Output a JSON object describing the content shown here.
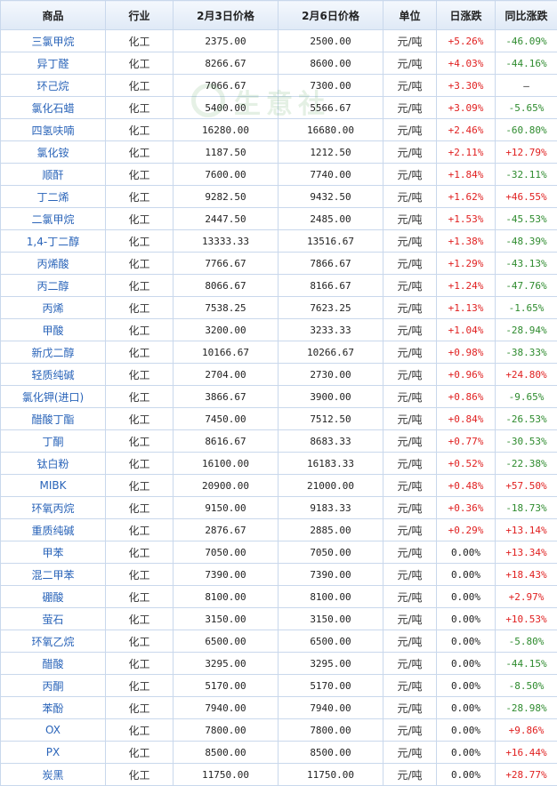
{
  "headers": [
    "商品",
    "行业",
    "2月3日价格",
    "2月6日价格",
    "单位",
    "日涨跌",
    "同比涨跌"
  ],
  "watermark_text": "生意社",
  "rows": [
    {
      "name": "三氯甲烷",
      "industry": "化工",
      "p1": "2375.00",
      "p2": "2500.00",
      "unit": "元/吨",
      "day": "+5.26%",
      "yoy": "-46.09%"
    },
    {
      "name": "异丁醛",
      "industry": "化工",
      "p1": "8266.67",
      "p2": "8600.00",
      "unit": "元/吨",
      "day": "+4.03%",
      "yoy": "-44.16%"
    },
    {
      "name": "环己烷",
      "industry": "化工",
      "p1": "7066.67",
      "p2": "7300.00",
      "unit": "元/吨",
      "day": "+3.30%",
      "yoy": "—"
    },
    {
      "name": "氯化石蜡",
      "industry": "化工",
      "p1": "5400.00",
      "p2": "5566.67",
      "unit": "元/吨",
      "day": "+3.09%",
      "yoy": "-5.65%"
    },
    {
      "name": "四氢呋喃",
      "industry": "化工",
      "p1": "16280.00",
      "p2": "16680.00",
      "unit": "元/吨",
      "day": "+2.46%",
      "yoy": "-60.80%"
    },
    {
      "name": "氯化铵",
      "industry": "化工",
      "p1": "1187.50",
      "p2": "1212.50",
      "unit": "元/吨",
      "day": "+2.11%",
      "yoy": "+12.79%"
    },
    {
      "name": "顺酐",
      "industry": "化工",
      "p1": "7600.00",
      "p2": "7740.00",
      "unit": "元/吨",
      "day": "+1.84%",
      "yoy": "-32.11%"
    },
    {
      "name": "丁二烯",
      "industry": "化工",
      "p1": "9282.50",
      "p2": "9432.50",
      "unit": "元/吨",
      "day": "+1.62%",
      "yoy": "+46.55%"
    },
    {
      "name": "二氯甲烷",
      "industry": "化工",
      "p1": "2447.50",
      "p2": "2485.00",
      "unit": "元/吨",
      "day": "+1.53%",
      "yoy": "-45.53%"
    },
    {
      "name": "1,4-丁二醇",
      "industry": "化工",
      "p1": "13333.33",
      "p2": "13516.67",
      "unit": "元/吨",
      "day": "+1.38%",
      "yoy": "-48.39%"
    },
    {
      "name": "丙烯酸",
      "industry": "化工",
      "p1": "7766.67",
      "p2": "7866.67",
      "unit": "元/吨",
      "day": "+1.29%",
      "yoy": "-43.13%"
    },
    {
      "name": "丙二醇",
      "industry": "化工",
      "p1": "8066.67",
      "p2": "8166.67",
      "unit": "元/吨",
      "day": "+1.24%",
      "yoy": "-47.76%"
    },
    {
      "name": "丙烯",
      "industry": "化工",
      "p1": "7538.25",
      "p2": "7623.25",
      "unit": "元/吨",
      "day": "+1.13%",
      "yoy": "-1.65%"
    },
    {
      "name": "甲酸",
      "industry": "化工",
      "p1": "3200.00",
      "p2": "3233.33",
      "unit": "元/吨",
      "day": "+1.04%",
      "yoy": "-28.94%"
    },
    {
      "name": "新戊二醇",
      "industry": "化工",
      "p1": "10166.67",
      "p2": "10266.67",
      "unit": "元/吨",
      "day": "+0.98%",
      "yoy": "-38.33%"
    },
    {
      "name": "轻质纯碱",
      "industry": "化工",
      "p1": "2704.00",
      "p2": "2730.00",
      "unit": "元/吨",
      "day": "+0.96%",
      "yoy": "+24.80%"
    },
    {
      "name": "氯化钾(进口)",
      "industry": "化工",
      "p1": "3866.67",
      "p2": "3900.00",
      "unit": "元/吨",
      "day": "+0.86%",
      "yoy": "-9.65%"
    },
    {
      "name": "醋酸丁酯",
      "industry": "化工",
      "p1": "7450.00",
      "p2": "7512.50",
      "unit": "元/吨",
      "day": "+0.84%",
      "yoy": "-26.53%"
    },
    {
      "name": "丁酮",
      "industry": "化工",
      "p1": "8616.67",
      "p2": "8683.33",
      "unit": "元/吨",
      "day": "+0.77%",
      "yoy": "-30.53%"
    },
    {
      "name": "钛白粉",
      "industry": "化工",
      "p1": "16100.00",
      "p2": "16183.33",
      "unit": "元/吨",
      "day": "+0.52%",
      "yoy": "-22.38%"
    },
    {
      "name": "MIBK",
      "industry": "化工",
      "p1": "20900.00",
      "p2": "21000.00",
      "unit": "元/吨",
      "day": "+0.48%",
      "yoy": "+57.50%"
    },
    {
      "name": "环氧丙烷",
      "industry": "化工",
      "p1": "9150.00",
      "p2": "9183.33",
      "unit": "元/吨",
      "day": "+0.36%",
      "yoy": "-18.73%"
    },
    {
      "name": "重质纯碱",
      "industry": "化工",
      "p1": "2876.67",
      "p2": "2885.00",
      "unit": "元/吨",
      "day": "+0.29%",
      "yoy": "+13.14%"
    },
    {
      "name": "甲苯",
      "industry": "化工",
      "p1": "7050.00",
      "p2": "7050.00",
      "unit": "元/吨",
      "day": "0.00%",
      "yoy": "+13.34%"
    },
    {
      "name": "混二甲苯",
      "industry": "化工",
      "p1": "7390.00",
      "p2": "7390.00",
      "unit": "元/吨",
      "day": "0.00%",
      "yoy": "+18.43%"
    },
    {
      "name": "硼酸",
      "industry": "化工",
      "p1": "8100.00",
      "p2": "8100.00",
      "unit": "元/吨",
      "day": "0.00%",
      "yoy": "+2.97%"
    },
    {
      "name": "萤石",
      "industry": "化工",
      "p1": "3150.00",
      "p2": "3150.00",
      "unit": "元/吨",
      "day": "0.00%",
      "yoy": "+10.53%"
    },
    {
      "name": "环氧乙烷",
      "industry": "化工",
      "p1": "6500.00",
      "p2": "6500.00",
      "unit": "元/吨",
      "day": "0.00%",
      "yoy": "-5.80%"
    },
    {
      "name": "醋酸",
      "industry": "化工",
      "p1": "3295.00",
      "p2": "3295.00",
      "unit": "元/吨",
      "day": "0.00%",
      "yoy": "-44.15%"
    },
    {
      "name": "丙酮",
      "industry": "化工",
      "p1": "5170.00",
      "p2": "5170.00",
      "unit": "元/吨",
      "day": "0.00%",
      "yoy": "-8.50%"
    },
    {
      "name": "苯酚",
      "industry": "化工",
      "p1": "7940.00",
      "p2": "7940.00",
      "unit": "元/吨",
      "day": "0.00%",
      "yoy": "-28.98%"
    },
    {
      "name": "OX",
      "industry": "化工",
      "p1": "7800.00",
      "p2": "7800.00",
      "unit": "元/吨",
      "day": "0.00%",
      "yoy": "+9.86%"
    },
    {
      "name": "PX",
      "industry": "化工",
      "p1": "8500.00",
      "p2": "8500.00",
      "unit": "元/吨",
      "day": "0.00%",
      "yoy": "+16.44%"
    },
    {
      "name": "炭黑",
      "industry": "化工",
      "p1": "11750.00",
      "p2": "11750.00",
      "unit": "元/吨",
      "day": "0.00%",
      "yoy": "+28.77%"
    }
  ]
}
